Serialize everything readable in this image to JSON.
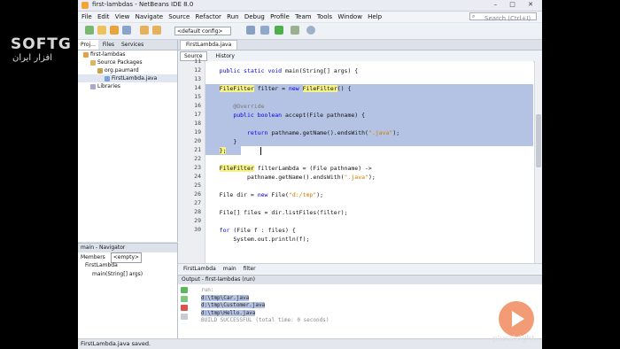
{
  "window": {
    "title": "first-lambdas - NetBeans IDE 8.0",
    "buttons": "– □ ✕"
  },
  "menu": [
    "File",
    "Edit",
    "View",
    "Navigate",
    "Source",
    "Refactor",
    "Run",
    "Debug",
    "Profile",
    "Team",
    "Tools",
    "Window",
    "Help"
  ],
  "search": {
    "placeholder": "Search (Ctrl+I)"
  },
  "toolbar": {
    "config": "<default config>"
  },
  "projects": {
    "tabs": [
      "Proj...",
      "Files",
      "Services"
    ],
    "tree": [
      {
        "label": "first-lambdas",
        "indent": 1
      },
      {
        "label": "Source Packages",
        "indent": 2
      },
      {
        "label": "org.paumard",
        "indent": 3
      },
      {
        "label": "FirstLambda.java",
        "indent": 4
      },
      {
        "label": "Libraries",
        "indent": 2
      }
    ]
  },
  "navigator": {
    "title": "main - Navigator",
    "members_label": "Members",
    "filter": "<empty>",
    "items": [
      "FirstLambda",
      "main(String[] args)"
    ]
  },
  "editor": {
    "tab": "FirstLambda.java",
    "modes": [
      "Source",
      "History"
    ],
    "line_numbers": [
      "11",
      "12",
      "13",
      "14",
      "15",
      "16",
      "17",
      "18",
      "19",
      "20",
      "21",
      "22",
      "23",
      "24",
      "25",
      "26",
      "27",
      "28",
      "29",
      "30"
    ],
    "breadcrumb": [
      "FirstLambda",
      "main",
      "filter"
    ]
  },
  "code_text": {
    "l12a": "    public static void main(String[] args) {",
    "l14_type": "FileFilter",
    "l14_mid": " filter = ",
    "l14_new": "new",
    "l14_type2": "FileFilter",
    "l14_end": "() {",
    "l16": "@Override",
    "l17_kw": "public boolean",
    "l17_end": " accept(File pathname) {",
    "l19_kw": "return",
    "l19_mid": " pathname.getName().endsWith(",
    "l19_str": "\".java\"",
    "l19_end": ");",
    "l20": "}",
    "l21": "};",
    "l23_type": "FileFilter",
    "l23_end": " filterLambda = (File pathname) ->",
    "l24_mid": "pathname.getName().endsWith(",
    "l24_str": "\".java\"",
    "l24_end": ");",
    "l26_a": "File dir = ",
    "l26_new": "new",
    "l26_b": " File(",
    "l26_str": "\"d:/tmp\"",
    "l26_c": ");",
    "l28": "File[] files = dir.listFiles(filter);",
    "l30_kw": "for",
    "l30_end": " (File f : files) {",
    "l31": "System.out.println(f);"
  },
  "output": {
    "title": "Output - first-lambdas (run)",
    "lines": [
      "run:",
      "d:\\tmp\\Car.java",
      "d:\\tmp\\Customer.java",
      "d:\\tmp\\Hello.java",
      "BUILD SUCCESSFUL (total time: 0 seconds)"
    ]
  },
  "status": "FirstLambda.java saved.",
  "watermark": {
    "brand": "SOFTG",
    "subtitle": "افزار ایران",
    "site": "pluralsight"
  },
  "colors": {
    "selection": "#b4c3e3",
    "keyword": "#0000e6",
    "string": "#ce7b00",
    "type_highlight": "#f5f28a"
  }
}
